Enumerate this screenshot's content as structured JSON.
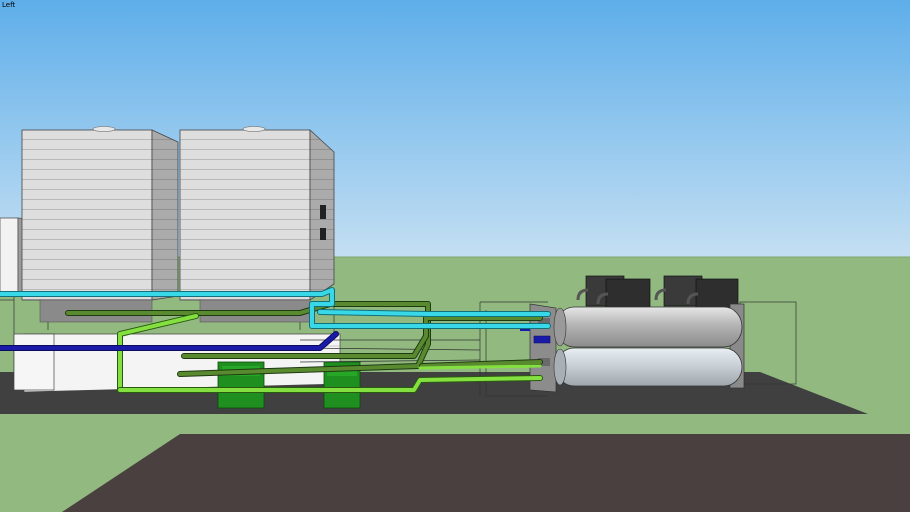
{
  "viewport": {
    "view_label": "Left"
  },
  "colors": {
    "sky_top": "#5eaeea",
    "sky_bottom": "#c4dff2",
    "ground": "#92ba80",
    "slab": "#404040",
    "road": "#4a4040",
    "tower_face": "#dcdcdc",
    "tower_side": "#a8a8a8",
    "chiller_shell": "#b8b8b8",
    "condenser_box": "#3a3a3a",
    "pump": "#1f8f1f",
    "pipe_cyan": "#38d8e8",
    "pipe_blue": "#1a1aa8",
    "pipe_light_green": "#84e040",
    "pipe_dark_green": "#5a8a30"
  },
  "scene_objects": [
    "cooling-tower-1",
    "cooling-tower-2",
    "chiller-unit",
    "condensing-units",
    "pump-1",
    "pump-2",
    "piping-network",
    "equipment-slab",
    "roadway"
  ]
}
